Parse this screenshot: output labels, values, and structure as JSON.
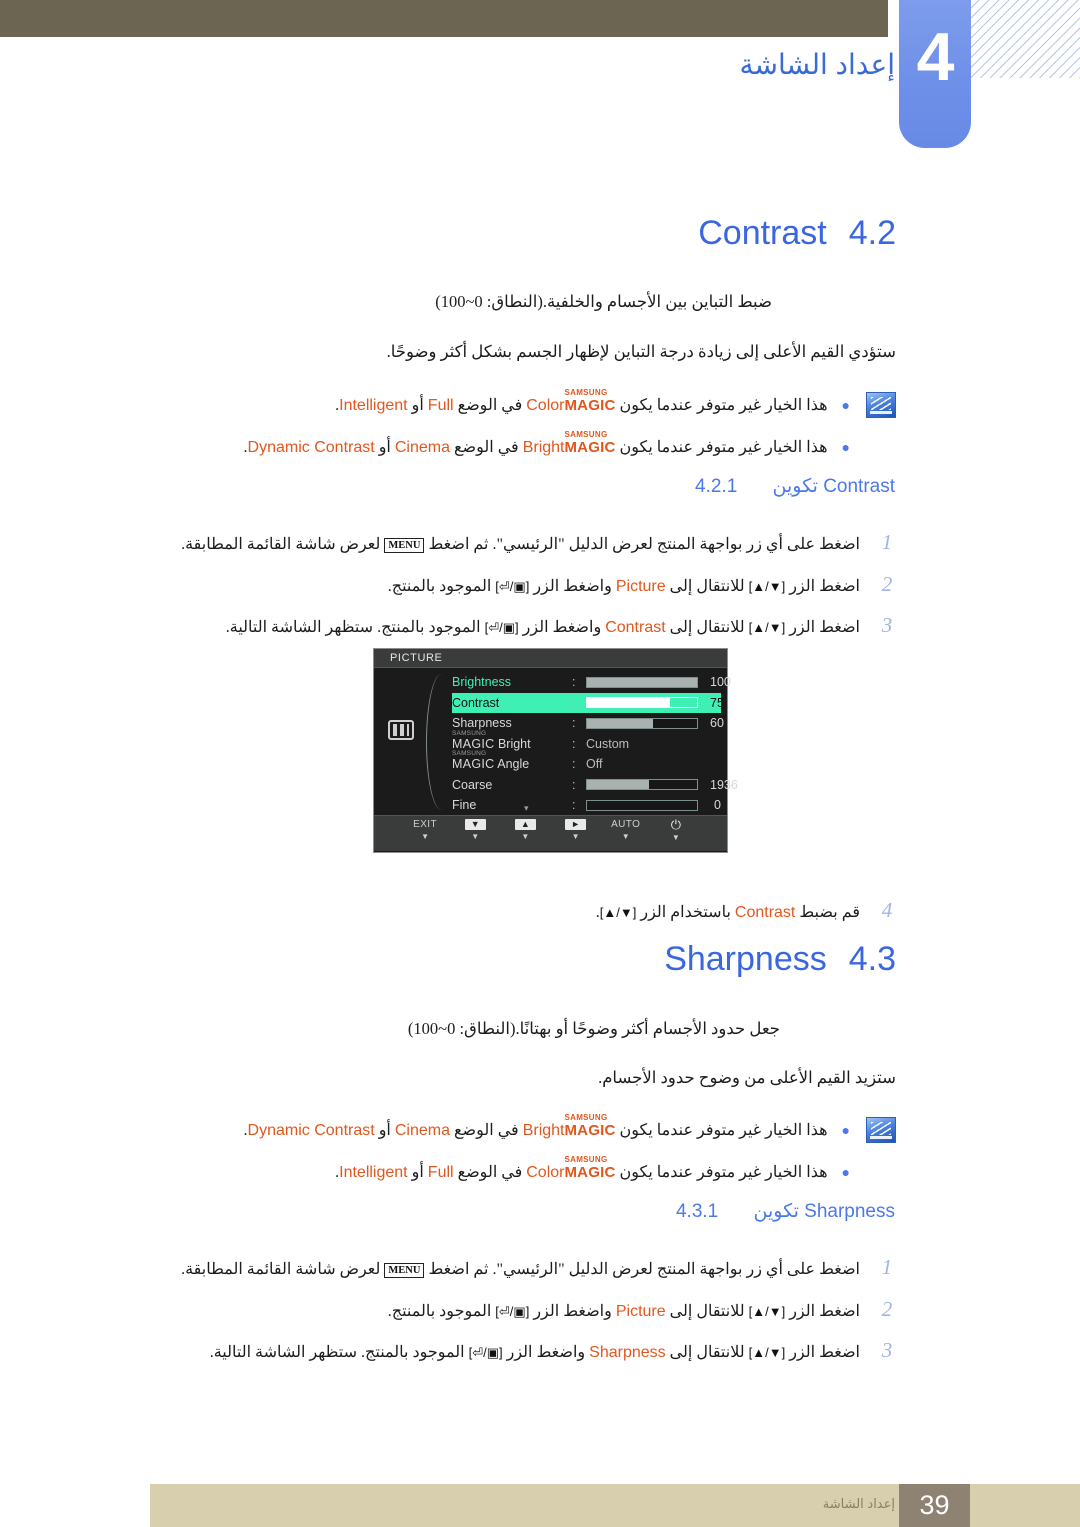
{
  "header": {
    "chapter_number": "4",
    "chapter_title": "إعداد الشاشة"
  },
  "sections": [
    {
      "id": "contrast",
      "number": "4.2",
      "title": "Contrast",
      "paragraphs": [
        "ضبط التباين بين الأجسام والخلفية.(النطاق: 0~100)",
        "ستؤدي القيم الأعلى إلى زيادة درجة التباين لإظهار الجسم بشكل أكثر وضوحًا."
      ],
      "notes": [
        {
          "pre": "هذا الخيار غير متوفر عندما يكون",
          "magic_sam": "SAMSUNG",
          "magic_mg": "MAGIC",
          "magic_suffix": "Color",
          "mid": "في الوضع",
          "opt1": "Full",
          "or": "أو",
          "opt2": "Intelligent",
          "end": "."
        },
        {
          "pre": "هذا الخيار غير متوفر عندما يكون",
          "magic_sam": "SAMSUNG",
          "magic_mg": "MAGIC",
          "magic_suffix": "Bright",
          "mid": "في الوضع",
          "opt1": "Cinema",
          "or": "أو",
          "opt2": "Dynamic Contrast",
          "end": "."
        }
      ],
      "subsection": {
        "number": "4.2.1",
        "label_ar": "تكوين",
        "label_en": "Contrast"
      },
      "steps": [
        {
          "num": "1",
          "a": "اضغط على أي زر بواجهة المنتج لعرض الدليل \"الرئيسي\". ثم اضغط",
          "key": "MENU",
          "b": "لعرض شاشة القائمة المطابقة."
        },
        {
          "num": "2",
          "a": "اضغط الزر",
          "key1": "[▲/▼]",
          "b": "للانتقال إلى",
          "target": "Picture",
          "c": "واضغط الزر",
          "key2": "[⏎/▣]",
          "d": "الموجود بالمنتج."
        },
        {
          "num": "3",
          "a": "اضغط الزر",
          "key1": "[▲/▼]",
          "b": "للانتقال إلى",
          "target": "Contrast",
          "c": "واضغط الزر",
          "key2": "[⏎/▣]",
          "d": "الموجود بالمنتج. ستظهر الشاشة التالية."
        },
        {
          "num": "4",
          "a": "قم بضبط",
          "target": "Contrast",
          "b": "باستخدام الزر",
          "key1": "[▲/▼]",
          "c": "."
        }
      ]
    },
    {
      "id": "sharpness",
      "number": "4.3",
      "title": "Sharpness",
      "paragraphs": [
        "جعل حدود الأجسام أكثر وضوحًا أو بهتانًا.(النطاق: 0~100)",
        "ستزيد القيم الأعلى من وضوح حدود الأجسام."
      ],
      "notes": [
        {
          "pre": "هذا الخيار غير متوفر عندما يكون",
          "magic_sam": "SAMSUNG",
          "magic_mg": "MAGIC",
          "magic_suffix": "Bright",
          "mid": "في الوضع",
          "opt1": "Cinema",
          "or": "أو",
          "opt2": "Dynamic Contrast",
          "end": "."
        },
        {
          "pre": "هذا الخيار غير متوفر عندما يكون",
          "magic_sam": "SAMSUNG",
          "magic_mg": "MAGIC",
          "magic_suffix": "Color",
          "mid": "في الوضع",
          "opt1": "Full",
          "or": "أو",
          "opt2": "Intelligent",
          "end": "."
        }
      ],
      "subsection": {
        "number": "4.3.1",
        "label_ar": "تكوين",
        "label_en": "Sharpness"
      },
      "steps": [
        {
          "num": "1",
          "a": "اضغط على أي زر بواجهة المنتج لعرض الدليل \"الرئيسي\". ثم اضغط",
          "key": "MENU",
          "b": "لعرض شاشة القائمة المطابقة."
        },
        {
          "num": "2",
          "a": "اضغط الزر",
          "key1": "[▲/▼]",
          "b": "للانتقال إلى",
          "target": "Picture",
          "c": "واضغط الزر",
          "key2": "[⏎/▣]",
          "d": "الموجود بالمنتج."
        },
        {
          "num": "3",
          "a": "اضغط الزر",
          "key1": "[▲/▼]",
          "b": "للانتقال إلى",
          "target": "Sharpness",
          "c": "واضغط الزر",
          "key2": "[⏎/▣]",
          "d": "الموجود بالمنتج. ستظهر الشاشة التالية."
        }
      ]
    }
  ],
  "osd": {
    "menu_title": "PICTURE",
    "rows": [
      {
        "label": "Brightness",
        "type": "bar",
        "fill_pct": 100,
        "value": "100"
      },
      {
        "label": "Contrast",
        "type": "bar",
        "fill_pct": 75,
        "value": "75",
        "highlight": true
      },
      {
        "label": "Sharpness",
        "type": "bar",
        "fill_pct": 60,
        "value": "60"
      },
      {
        "label_sam": "SAMSUNG",
        "label_mg": "MAGIC",
        "label_suffix": " Bright",
        "type": "text",
        "value": "Custom"
      },
      {
        "label_sam": "SAMSUNG",
        "label_mg": "MAGIC",
        "label_suffix": " Angle",
        "type": "text",
        "value": "Off"
      },
      {
        "label": "Coarse",
        "type": "bar",
        "fill_pct": 56,
        "value": "1936"
      },
      {
        "label": "Fine",
        "type": "bar",
        "fill_pct": 0,
        "value": "0"
      }
    ],
    "footer": [
      {
        "label": "EXIT",
        "kind": "text"
      },
      {
        "label": "▼",
        "kind": "btn"
      },
      {
        "label": "▲",
        "kind": "btn"
      },
      {
        "label": "►",
        "kind": "btn"
      },
      {
        "label": "AUTO",
        "kind": "text"
      },
      {
        "label": "⏻",
        "kind": "power"
      }
    ],
    "scroll_caret": "▾"
  },
  "footer": {
    "page_number": "39",
    "chapter_label": "إعداد الشاشة"
  },
  "colors": {
    "heading_blue": "#3a66e0",
    "subsection_blue": "#4b79e8",
    "accent_orange": "#e2571e",
    "header_olive": "#6b6551",
    "tab_blue": "#7d9cec",
    "footer_tan": "#d8cfae",
    "footer_num_bg": "#8e8273",
    "osd_highlight": "#3ff0b4"
  }
}
